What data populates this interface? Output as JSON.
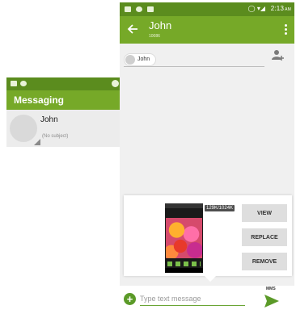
{
  "list_screen": {
    "app_title": "Messaging",
    "conversations": [
      {
        "name": "John",
        "subject": "(No subject)"
      }
    ]
  },
  "conversation": {
    "status_bar": {
      "time": "2:13",
      "ampm": "AM"
    },
    "title": "John",
    "subtitle": "10086",
    "recipient_chip": "John",
    "attachment": {
      "size_label": "129K/1024K",
      "buttons": {
        "view": "VIEW",
        "replace": "REPLACE",
        "remove": "REMOVE"
      }
    },
    "compose": {
      "placeholder": "Type text message",
      "mode_label": "MMS"
    }
  },
  "colors": {
    "status_bar": "#5b8c1e",
    "app_bar": "#76a928",
    "accent": "#5b9a28"
  },
  "icons": [
    "back-arrow-icon",
    "more-vert-icon",
    "add-contact-icon",
    "add-attachment-icon",
    "send-icon"
  ]
}
